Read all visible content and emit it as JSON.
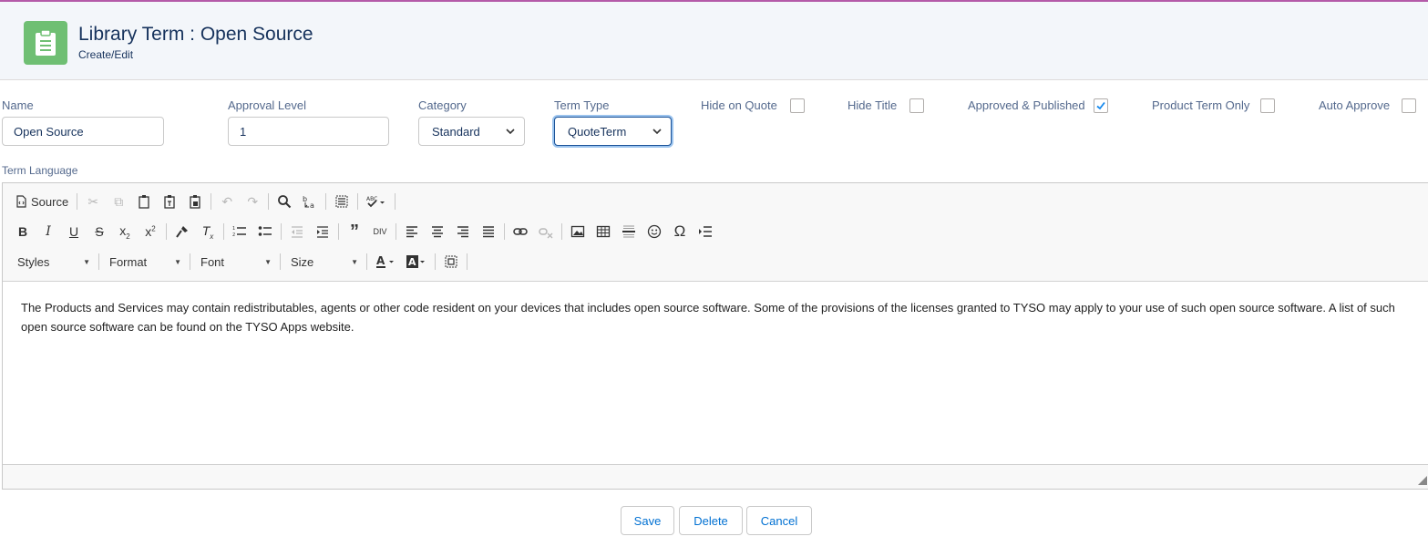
{
  "header": {
    "title": "Library Term : Open Source",
    "subtitle": "Create/Edit",
    "icon": "clipboard-icon",
    "accent": "#6fbf73"
  },
  "form": {
    "name": {
      "label": "Name",
      "value": "Open Source"
    },
    "approval_level": {
      "label": "Approval Level",
      "value": "1"
    },
    "category": {
      "label": "Category",
      "value": "Standard"
    },
    "term_type": {
      "label": "Term Type",
      "value": "QuoteTerm"
    },
    "checkboxes": {
      "hide_on_quote": {
        "label": "Hide on Quote",
        "checked": false
      },
      "hide_title": {
        "label": "Hide Title",
        "checked": false
      },
      "approved_published": {
        "label": "Approved & Published",
        "checked": true
      },
      "product_term_only": {
        "label": "Product Term Only",
        "checked": false
      },
      "auto_approve": {
        "label": "Auto Approve",
        "checked": false
      }
    },
    "term_language_label": "Term Language"
  },
  "editor": {
    "source_label": "Source",
    "combos": {
      "styles": "Styles",
      "format": "Format",
      "font": "Font",
      "size": "Size"
    },
    "content": "The Products and Services may contain redistributables, agents or other code resident on your devices that includes open source software. Some of the provisions of the licenses granted to TYSO may apply to your use of such open source software. A list of such open source software can be found on the TYSO Apps website."
  },
  "actions": {
    "save": "Save",
    "delete": "Delete",
    "cancel": "Cancel"
  }
}
